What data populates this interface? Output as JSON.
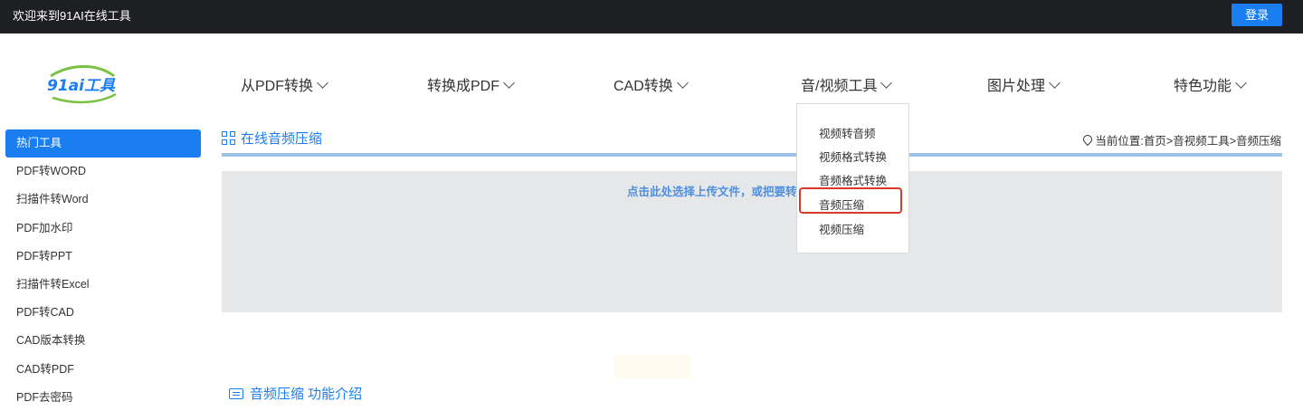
{
  "topbar": {
    "welcome": "欢迎来到91AI在线工具",
    "login": "登录"
  },
  "logo": {
    "text": "91ai工具",
    "color_main": "#1a7ef0",
    "color_accent": "#7cc242"
  },
  "nav": [
    {
      "label": "从PDF转换"
    },
    {
      "label": "转换成PDF"
    },
    {
      "label": "CAD转换"
    },
    {
      "label": "音/视频工具"
    },
    {
      "label": "图片处理"
    },
    {
      "label": "特色功能"
    }
  ],
  "sidebar": [
    {
      "label": "热门工具",
      "active": true
    },
    {
      "label": "PDF转WORD"
    },
    {
      "label": "扫描件转Word"
    },
    {
      "label": "PDF加水印"
    },
    {
      "label": "PDF转PPT"
    },
    {
      "label": "扫描件转Excel"
    },
    {
      "label": "PDF转CAD"
    },
    {
      "label": "CAD版本转换"
    },
    {
      "label": "CAD转PDF"
    },
    {
      "label": "PDF去密码"
    }
  ],
  "section": {
    "title": "在线音频压缩",
    "breadcrumb": "当前位置:首页>音视频工具>音频压缩"
  },
  "upload": {
    "text": "点击此处选择上传文件，或把要转"
  },
  "intro": {
    "title": "音频压缩 功能介绍"
  },
  "dropdown": [
    {
      "label": "视频转音频"
    },
    {
      "label": "视频格式转换"
    },
    {
      "label": "音频格式转换"
    },
    {
      "label": "音频压缩",
      "highlighted": true
    },
    {
      "label": "视频压缩"
    }
  ],
  "colors": {
    "accent": "#1a7ef0",
    "topbar": "#1e1f22",
    "upload_bg": "#e6e7e9",
    "highlight": "#d93b2b"
  }
}
